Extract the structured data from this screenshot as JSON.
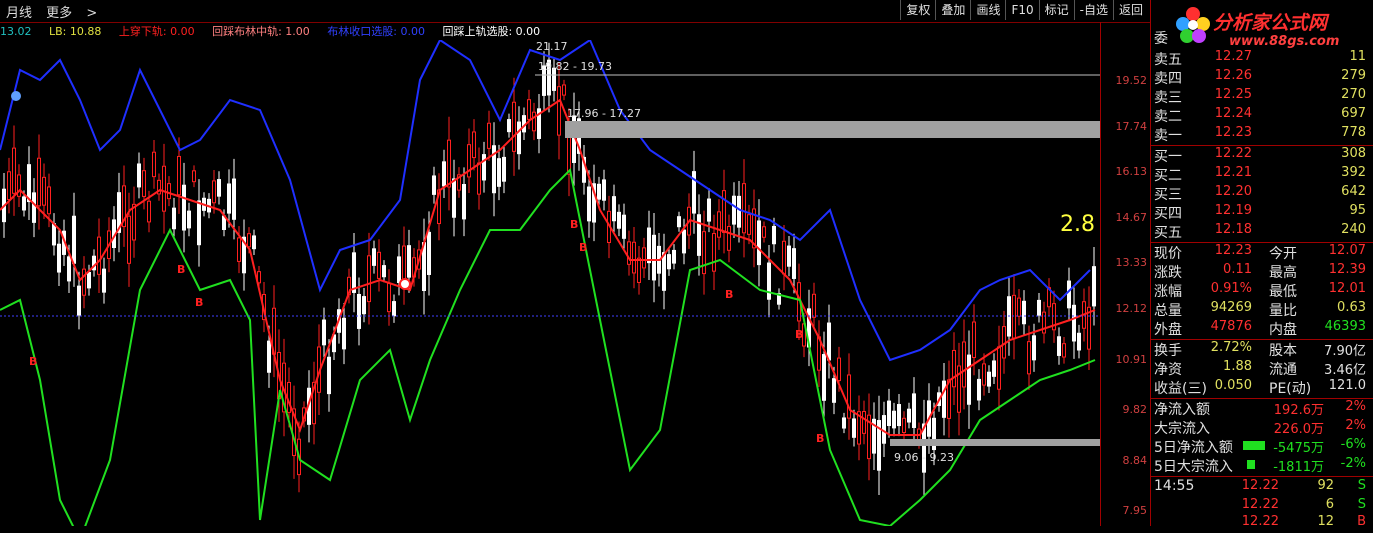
{
  "toolbar": {
    "period": "月线",
    "more": "更多",
    "arrow": ">",
    "buttons": [
      "复权",
      "叠加",
      "画线",
      "F10",
      "标记",
      "-自选",
      "返回"
    ]
  },
  "legend": {
    "date": "13.02",
    "lb": "LB: 10.88",
    "item1": "上穿下轨: 0.00",
    "item2": "回踩布林中轨: 1.00",
    "item3": "布林收口选股: 0.00",
    "item4": "回踩上轨选股: 0.00"
  },
  "chart": {
    "price_labels": [
      "19.52",
      "17.74",
      "16.13",
      "14.67",
      "13.33",
      "12.12",
      "10.91",
      "9.82",
      "8.84",
      "7.95"
    ],
    "box1": "19.82 - 19.73",
    "box2": "17.96 - 17.27",
    "box3": "9.06 - 9.23",
    "high_label": "21.17",
    "big_number": "2.8",
    "b_labels": [
      "B",
      "B",
      "B",
      "B",
      "B",
      "B",
      "B",
      "B"
    ],
    "colors": {
      "upper": "#1f2fff",
      "mid": "#ff2020",
      "lower": "#20e020",
      "candle_up": "#ff2020",
      "candle_down": "#ffffff"
    }
  },
  "panel": {
    "logo_text": "分析家公式网",
    "logo_url": "www.88gs.com",
    "header": "委",
    "sells": [
      {
        "label": "卖五",
        "price": "12.27",
        "vol": "11"
      },
      {
        "label": "卖四",
        "price": "12.26",
        "vol": "279"
      },
      {
        "label": "卖三",
        "price": "12.25",
        "vol": "270"
      },
      {
        "label": "卖二",
        "price": "12.24",
        "vol": "697"
      },
      {
        "label": "卖一",
        "price": "12.23",
        "vol": "778"
      }
    ],
    "buys": [
      {
        "label": "买一",
        "price": "12.22",
        "vol": "308"
      },
      {
        "label": "买二",
        "price": "12.21",
        "vol": "392"
      },
      {
        "label": "买三",
        "price": "12.20",
        "vol": "642"
      },
      {
        "label": "买四",
        "price": "12.19",
        "vol": "95"
      },
      {
        "label": "买五",
        "price": "12.18",
        "vol": "240"
      }
    ],
    "quote": [
      {
        "l1": "现价",
        "v1": "12.23",
        "l2": "今开",
        "v2": "12.07"
      },
      {
        "l1": "涨跌",
        "v1": "0.11",
        "l2": "最高",
        "v2": "12.39"
      },
      {
        "l1": "涨幅",
        "v1": "0.91%",
        "l2": "最低",
        "v2": "12.01"
      },
      {
        "l1": "总量",
        "v1": "94269",
        "l2": "量比",
        "v2": "0.63"
      },
      {
        "l1": "外盘",
        "v1": "47876",
        "l2": "内盘",
        "v2": "46393"
      }
    ],
    "fin": [
      {
        "l1": "换手",
        "v1": "2.72%",
        "l2": "股本",
        "v2": "7.90亿"
      },
      {
        "l1": "净资",
        "v1": "1.88",
        "l2": "流通",
        "v2": "3.46亿"
      },
      {
        "l1": "收益(三)",
        "v1": "0.050",
        "l2": "PE(动)",
        "v2": "121.0"
      }
    ],
    "flow": [
      {
        "label": "净流入额",
        "value": "192.6万",
        "pct": "2%"
      },
      {
        "label": "大宗流入",
        "value": "226.0万",
        "pct": "2%"
      },
      {
        "label": "5日净流入额",
        "value": "-5475万",
        "pct": "-6%"
      },
      {
        "label": "5日大宗流入",
        "value": "-1811万",
        "pct": "-2%"
      }
    ],
    "ticks": [
      {
        "time": "14:55",
        "price": "12.22",
        "vol": "92",
        "side": "S"
      },
      {
        "time": "",
        "price": "12.22",
        "vol": "6",
        "side": "S"
      },
      {
        "time": "",
        "price": "12.22",
        "vol": "12",
        "side": "B"
      }
    ]
  }
}
